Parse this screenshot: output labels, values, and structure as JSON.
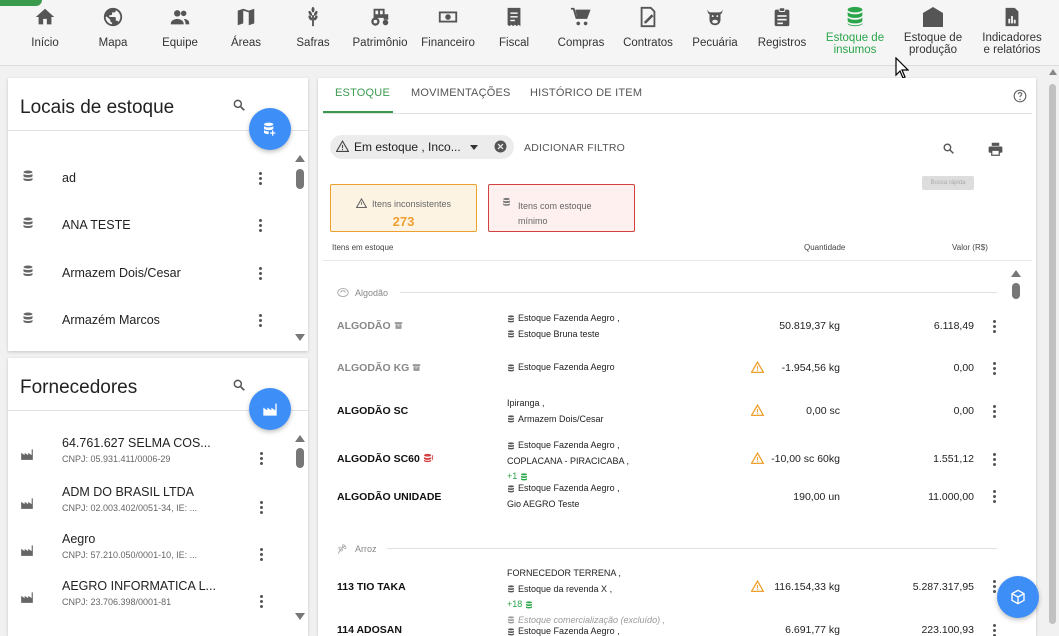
{
  "nav": {
    "items": [
      {
        "label": "Início",
        "icon": "home-icon"
      },
      {
        "label": "Mapa",
        "icon": "globe-icon"
      },
      {
        "label": "Equipe",
        "icon": "people-icon"
      },
      {
        "label": "Áreas",
        "icon": "map-icon"
      },
      {
        "label": "Safras",
        "icon": "wheat-icon"
      },
      {
        "label": "Patrimônio",
        "icon": "tractor-icon"
      },
      {
        "label": "Financeiro",
        "icon": "money-icon"
      },
      {
        "label": "Fiscal",
        "icon": "receipt-icon"
      },
      {
        "label": "Compras",
        "icon": "cart-icon"
      },
      {
        "label": "Contratos",
        "icon": "contract-icon"
      },
      {
        "label": "Pecuária",
        "icon": "cow-icon"
      },
      {
        "label": "Registros",
        "icon": "clipboard-icon"
      },
      {
        "label_1": "Estoque de",
        "label_2": "insumos",
        "icon": "database-icon"
      },
      {
        "label_1": "Estoque de",
        "label_2": "produção",
        "icon": "warehouse-icon"
      },
      {
        "label_1": "Indicadores",
        "label_2": "e relatórios",
        "icon": "report-icon"
      }
    ],
    "active_color": "#2aa54a"
  },
  "locais": {
    "title": "Locais de estoque",
    "items": [
      "ad",
      "ANA TESTE",
      "Armazem Dois/Cesar",
      "Armazém Marcos"
    ]
  },
  "fornecedores": {
    "title": "Fornecedores",
    "items": [
      {
        "name": "64.761.627 SELMA COS...",
        "cnpj": "CNPJ: 05.931.411/0006-29"
      },
      {
        "name": "ADM DO BRASIL LTDA",
        "cnpj": "CNPJ: 02.003.402/0051-34, IE: ..."
      },
      {
        "name": "Aegro",
        "cnpj": "CNPJ: 57.210.050/0001-10, IE: ..."
      },
      {
        "name": "AEGRO INFORMATICA L...",
        "cnpj": "CNPJ: 23.706.398/0001-81"
      }
    ]
  },
  "tabs": [
    "ESTOQUE",
    "MOVIMENTAÇÕES",
    "HISTÓRICO DE ITEM"
  ],
  "filter": {
    "chip": "Em estoque , Inco...",
    "add": "ADICIONAR FILTRO",
    "tooltip": "Busca rápida"
  },
  "cards": {
    "inconsistent": {
      "label": "Itens inconsistentes",
      "count": "273"
    },
    "minimum": {
      "label_1": "Itens com estoque",
      "label_2": "mínimo"
    }
  },
  "table": {
    "headers": {
      "item": "Itens em estoque",
      "qty": "Quantidade",
      "value": "Valor (R$)"
    },
    "groups": {
      "algodao": "Algodão",
      "arroz": "Arroz"
    },
    "rows": [
      {
        "name": "ALGODÃO",
        "loc1": "Estoque Fazenda Aegro ,",
        "loc2": "Estoque Bruna teste",
        "qty": "50.819,37 kg",
        "value": "6.118,49"
      },
      {
        "name": "ALGODÃO KG",
        "loc1": "Estoque Fazenda Aegro",
        "qty": "-1.954,56 kg",
        "value": "0,00"
      },
      {
        "name": "ALGODÃO SC",
        "loc1": "Ipiranga ,",
        "loc2": "Armazem Dois/Cesar",
        "qty": "0,00 sc",
        "value": "0,00"
      },
      {
        "name": "ALGODÃO SC60",
        "loc1": "Estoque Fazenda Aegro ,",
        "loc2": "COPLACANA - PIRACICABA ,",
        "more": "+1",
        "qty": "-10,00 sc 60kg",
        "value": "1.551,12"
      },
      {
        "name": "ALGODÃO UNIDADE",
        "loc1": "Estoque Fazenda Aegro ,",
        "loc2": "Gio AEGRO Teste",
        "qty": "190,00 un",
        "value": "11.000,00"
      },
      {
        "name": "113 TIO TAKA",
        "loc1": "FORNECEDOR TERRENA ,",
        "loc2": "Estoque da revenda X ,",
        "more": "+18",
        "loc3": "Estoque comercialização (excluído) ,",
        "qty": "116.154,33 kg",
        "value": "5.287.317,95"
      },
      {
        "name": "114 ADOSAN",
        "loc1": "Estoque Fazenda Aegro ,",
        "qty": "6.691,77 kg",
        "value": "223.100,93"
      }
    ]
  },
  "colors": {
    "accent_green": "#3a9b4f",
    "fab_blue": "#3e8ef7",
    "warn_orange": "#f0a030",
    "alert_red": "#d44040"
  }
}
